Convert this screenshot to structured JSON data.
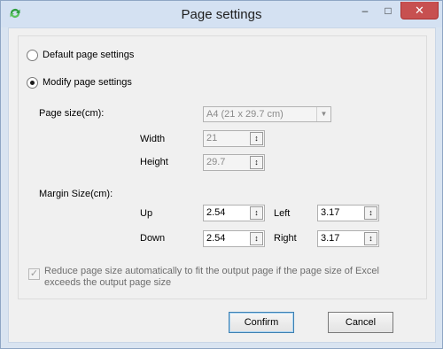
{
  "window": {
    "title": "Page settings",
    "minimize_label": "‒",
    "maximize_label": "□",
    "close_label": "✕"
  },
  "mode": {
    "default_label": "Default page settings",
    "modify_label": "Modify page settings",
    "selected": "modify"
  },
  "page_size": {
    "label": "Page size(cm):",
    "selected": "A4 (21 x 29.7 cm)",
    "width_label": "Width",
    "width_value": "21",
    "height_label": "Height",
    "height_value": "29.7"
  },
  "margin": {
    "label": "Margin Size(cm):",
    "up_label": "Up",
    "up_value": "2.54",
    "left_label": "Left",
    "left_value": "3.17",
    "down_label": "Down",
    "down_value": "2.54",
    "right_label": "Right",
    "right_value": "3.17"
  },
  "auto_reduce": {
    "label": "Reduce page size automatically to fit the output page if the page size of Excel exceeds the output page size",
    "checked": true
  },
  "buttons": {
    "confirm_label": "Confirm",
    "cancel_label": "Cancel"
  }
}
